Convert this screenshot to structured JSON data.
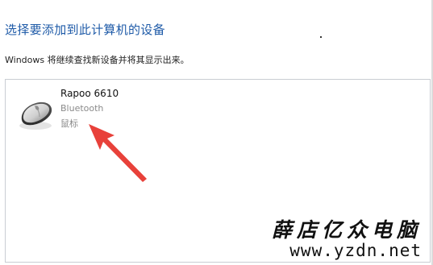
{
  "header": {
    "title": "选择要添加到此计算机的设备",
    "subtitle": "Windows 将继续查找新设备并将其显示出来。"
  },
  "devices": [
    {
      "name": "Rapoo 6610",
      "connection": "Bluetooth",
      "type": "鼠标",
      "icon": "mouse-icon"
    }
  ],
  "annotation": {
    "arrow_color": "#e8413a",
    "icon": "red-arrow"
  },
  "watermark": {
    "brand": "薛店亿众电脑",
    "url": "www.yzdn.net"
  },
  "colors": {
    "title": "#1f5ba8",
    "secondary_text": "#8a8a8a",
    "list_border": "#c9cdd3"
  }
}
